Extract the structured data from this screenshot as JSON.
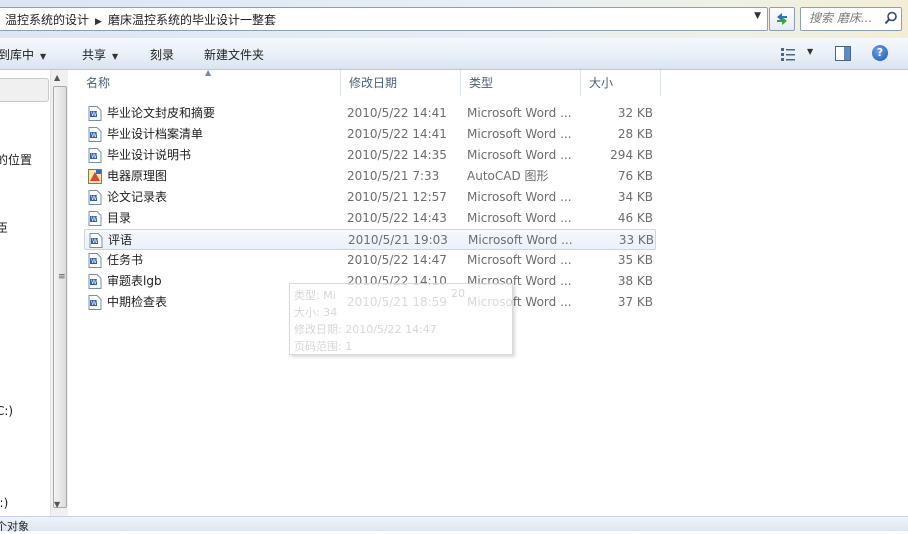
{
  "address": {
    "crumbs": [
      "温控系统的设计",
      "磨床温控系统的毕业设计一整套"
    ]
  },
  "search": {
    "placeholder": "搜索 磨床..."
  },
  "toolbar": {
    "include_library": "到库中",
    "share": "共享",
    "burn": "刻录",
    "new_folder": "新建文件夹"
  },
  "nav": {
    "items": [
      {
        "label": "的位置"
      },
      {
        "label": "臣"
      },
      {
        "label": "C:)"
      },
      {
        "label": "I:)"
      }
    ]
  },
  "columns": {
    "name": "名称",
    "date": "修改日期",
    "type": "类型",
    "size": "大小"
  },
  "files": [
    {
      "name": "毕业论文封皮和摘要",
      "date": "2010/5/22 14:41",
      "type": "Microsoft Word ...",
      "size": "32 KB",
      "icon": "word-doc-icon"
    },
    {
      "name": "毕业设计档案清单",
      "date": "2010/5/22 14:41",
      "type": "Microsoft Word ...",
      "size": "28 KB",
      "icon": "word-doc-icon"
    },
    {
      "name": "毕业设计说明书",
      "date": "2010/5/22 14:35",
      "type": "Microsoft Word ...",
      "size": "294 KB",
      "icon": "word-doc-icon"
    },
    {
      "name": "电器原理图",
      "date": "2010/5/21 7:33",
      "type": "AutoCAD 图形",
      "size": "76 KB",
      "icon": "autocad-drawing-icon"
    },
    {
      "name": "论文记录表",
      "date": "2010/5/21 12:57",
      "type": "Microsoft Word ...",
      "size": "34 KB",
      "icon": "word-doc-icon"
    },
    {
      "name": "目录",
      "date": "2010/5/22 14:43",
      "type": "Microsoft Word ...",
      "size": "46 KB",
      "icon": "word-doc-icon"
    },
    {
      "name": "评语",
      "date": "2010/5/21 19:03",
      "type": "Microsoft Word ...",
      "size": "33 KB",
      "icon": "word-doc-icon"
    },
    {
      "name": "任务书",
      "date": "2010/5/22 14:47",
      "type": "Microsoft Word ...",
      "size": "35 KB",
      "icon": "word-doc-icon"
    },
    {
      "name": "审题表lgb",
      "date": "2010/5/22 14:10",
      "type": "Microsoft Word ...",
      "size": "38 KB",
      "icon": "word-doc-icon"
    },
    {
      "name": "中期检查表",
      "date": "2010/5/21 18:59",
      "type": "Microsoft Word ...",
      "size": "37 KB",
      "icon": "word-doc-icon"
    }
  ],
  "selected_file_index": 6,
  "tooltip": {
    "lines": [
      "类型: Mi",
      "大小: 34",
      "修改日期: 2010/5/22 14:47",
      "页码范围: 1"
    ],
    "trail": "20"
  },
  "status": {
    "text": "个对象"
  },
  "colors": {
    "accent": "#1d56b7",
    "selection_border": "#c8d6ea",
    "toolbar_bg": "#dae4f0"
  }
}
